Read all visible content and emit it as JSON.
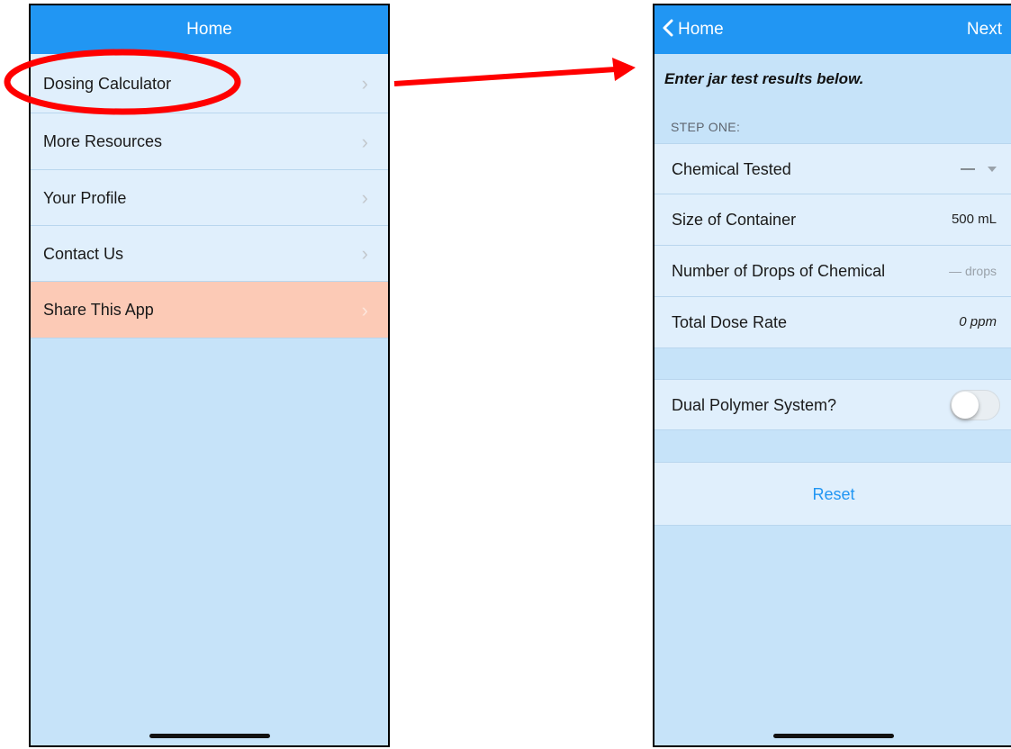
{
  "left_screen": {
    "nav_title": "Home",
    "menu_items": [
      {
        "label": "Dosing Calculator",
        "icon": "chevron-right-icon"
      },
      {
        "label": "More Resources",
        "icon": "chevron-right-icon"
      },
      {
        "label": "Your Profile",
        "icon": "chevron-right-icon"
      },
      {
        "label": "Contact Us",
        "icon": "chevron-right-icon"
      },
      {
        "label": "Share This App",
        "icon": "chevron-right-icon",
        "highlight_color": "#fccab6"
      }
    ]
  },
  "right_screen": {
    "back_label": "Home",
    "next_label": "Next",
    "instruction": "Enter jar test results below.",
    "section_header": "STEP ONE:",
    "fields": [
      {
        "label": "Chemical Tested",
        "value": "—",
        "icon": "dropdown-caret-icon"
      },
      {
        "label": "Size of Container",
        "value": "500 mL"
      },
      {
        "label": "Number of Drops of Chemical",
        "value": "— drops"
      },
      {
        "label": "Total Dose Rate",
        "value": "0 ppm"
      }
    ],
    "dual_polymer": {
      "label": "Dual Polymer System?",
      "on": false
    },
    "reset_label": "Reset"
  },
  "colors": {
    "nav_bar": "#2196f3",
    "screen_background": "#c6e3f9",
    "row_background": "#e0effc",
    "highlight_row": "#fccab6",
    "link": "#2196f3",
    "annotation": "#ff0000"
  }
}
